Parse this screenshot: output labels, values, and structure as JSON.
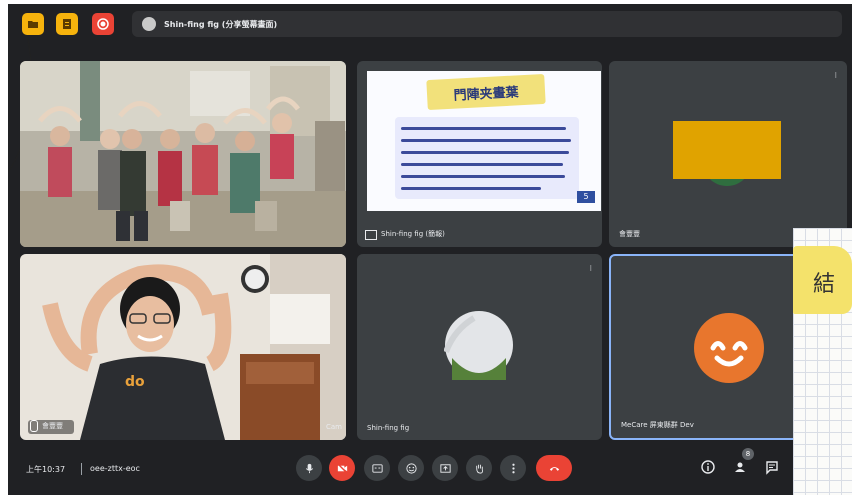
{
  "topbar": {
    "buttons": [
      {
        "icon": "folder-icon",
        "color": "#f6b30d"
      },
      {
        "icon": "document-icon",
        "color": "#f6b30d"
      },
      {
        "icon": "record-icon",
        "color": "#ea4335"
      }
    ],
    "title": "Shin-fing fig (分享螢幕畫面)"
  },
  "tiles": {
    "room_name": "",
    "slide": {
      "banner": "門陣夹畫葉",
      "name": "Shin-fing fig (簡報)",
      "page_number": "5"
    },
    "participant3": {
      "name": "會豐豐",
      "placeholder_color": "#e0a300"
    },
    "presenter": {
      "name": "會豐豐",
      "shirt_text": "do",
      "corner_text": "Cam"
    },
    "participant5": {
      "name": "Shin-fing fig"
    },
    "participant6": {
      "name": "MeCare 屏東縣群 Dev",
      "avatar_color": "#e8762d"
    }
  },
  "bottombar": {
    "time": "上午10:37",
    "meeting_code": "oee-zttx-eoc",
    "participant_count": "8"
  },
  "overlay": {
    "char": "結"
  },
  "colors": {
    "background": "#202124",
    "tile": "#3c4043",
    "accent_red": "#ea4335"
  }
}
